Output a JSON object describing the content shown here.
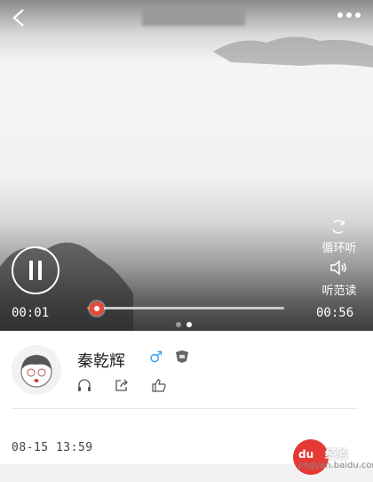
{
  "player": {
    "time_current": "00:01",
    "time_total": "00:56",
    "progress": 0.05,
    "loop_label": "循环听",
    "read_label": "听范读",
    "pager": {
      "count": 2,
      "active": 1
    }
  },
  "user": {
    "name": "秦乾辉",
    "gender_symbol": "♂"
  },
  "post": {
    "date": "08-15 13:59"
  },
  "watermark": {
    "logo_text": "du",
    "text": "经验",
    "url": "jingyan.baidu.com"
  },
  "colors": {
    "accent": "#e74a3b",
    "gender": "#3aa0f0"
  },
  "icons": {
    "back": "chevron-left-icon",
    "more": "more-dots-icon",
    "loop": "loop-icon",
    "speaker": "speaker-icon",
    "pause": "pause-icon",
    "listen": "headphones-icon",
    "share": "share-icon",
    "like": "thumbs-up-icon"
  }
}
